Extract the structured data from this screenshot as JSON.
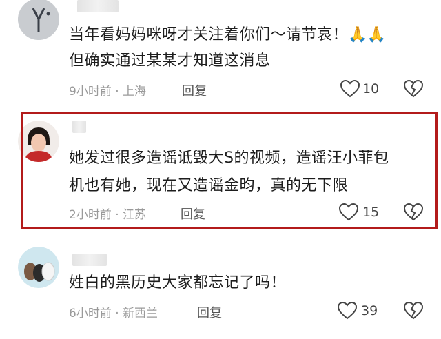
{
  "comments": [
    {
      "text_line1": "当年看妈妈咪呀才关注着你们～请节哀！🙏🙏",
      "text_line2": "但确实通过某某才知道这消息",
      "time": "9小时前",
      "location": "上海",
      "reply_label": "回复",
      "likes": "10"
    },
    {
      "text_line1": "她发过很多造谣诋毁大S的视频，造谣汪小菲包",
      "text_line2": "机也有她，现在又造谣金昀，真的无下限",
      "time": "2小时前",
      "location": "江苏",
      "reply_label": "回复",
      "likes": "15"
    },
    {
      "text_line1": "姓白的黑历史大家都忘记了吗！",
      "time": "6小时前",
      "location": "新西兰",
      "reply_label": "回复",
      "likes": "39"
    }
  ],
  "colors": {
    "highlight_border": "#b31b1b",
    "meta_text": "#9a9a9a"
  }
}
